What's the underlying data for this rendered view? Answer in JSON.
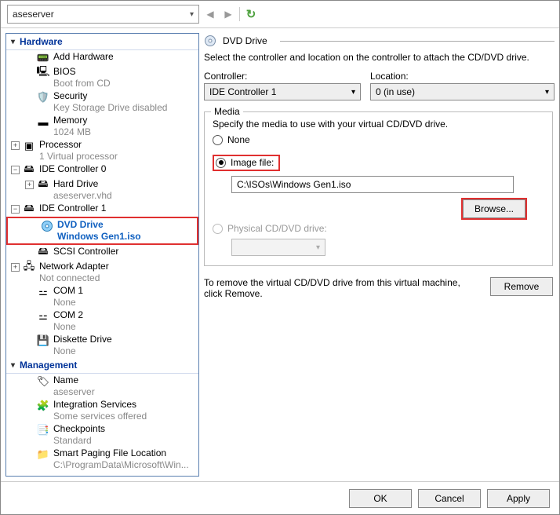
{
  "toolbar": {
    "vm_selector": "aseserver"
  },
  "sidebar": {
    "hardware_header": "Hardware",
    "management_header": "Management",
    "items": {
      "add_hardware": "Add Hardware",
      "bios": "BIOS",
      "bios_sub": "Boot from CD",
      "security": "Security",
      "security_sub": "Key Storage Drive disabled",
      "memory": "Memory",
      "memory_sub": "1024 MB",
      "processor": "Processor",
      "processor_sub": "1 Virtual processor",
      "ide0": "IDE Controller 0",
      "hard_drive": "Hard Drive",
      "hard_drive_sub": "aseserver.vhd",
      "ide1": "IDE Controller 1",
      "dvd": "DVD Drive",
      "dvd_sub": "Windows Gen1.iso",
      "scsi": "SCSI Controller",
      "netadapter": "Network Adapter",
      "netadapter_sub": "Not connected",
      "com1": "COM 1",
      "com1_sub": "None",
      "com2": "COM 2",
      "com2_sub": "None",
      "diskette": "Diskette Drive",
      "diskette_sub": "None",
      "name": "Name",
      "name_sub": "aseserver",
      "integ": "Integration Services",
      "integ_sub": "Some services offered",
      "checkpoints": "Checkpoints",
      "checkpoints_sub": "Standard",
      "paging": "Smart Paging File Location",
      "paging_sub": "C:\\ProgramData\\Microsoft\\Win..."
    }
  },
  "pane": {
    "title": "DVD Drive",
    "intro": "Select the controller and location on the controller to attach the CD/DVD drive.",
    "controller_label": "Controller:",
    "controller_value": "IDE Controller 1",
    "location_label": "Location:",
    "location_value": "0 (in use)",
    "media_legend": "Media",
    "media_desc": "Specify the media to use with your virtual CD/DVD drive.",
    "radio_none": "None",
    "radio_image": "Image file:",
    "image_path": "C:\\ISOs\\Windows Gen1.iso",
    "browse": "Browse...",
    "radio_physical": "Physical CD/DVD drive:",
    "remove_desc": "To remove the virtual CD/DVD drive from this virtual machine, click Remove.",
    "remove": "Remove"
  },
  "buttons": {
    "ok": "OK",
    "cancel": "Cancel",
    "apply": "Apply"
  }
}
